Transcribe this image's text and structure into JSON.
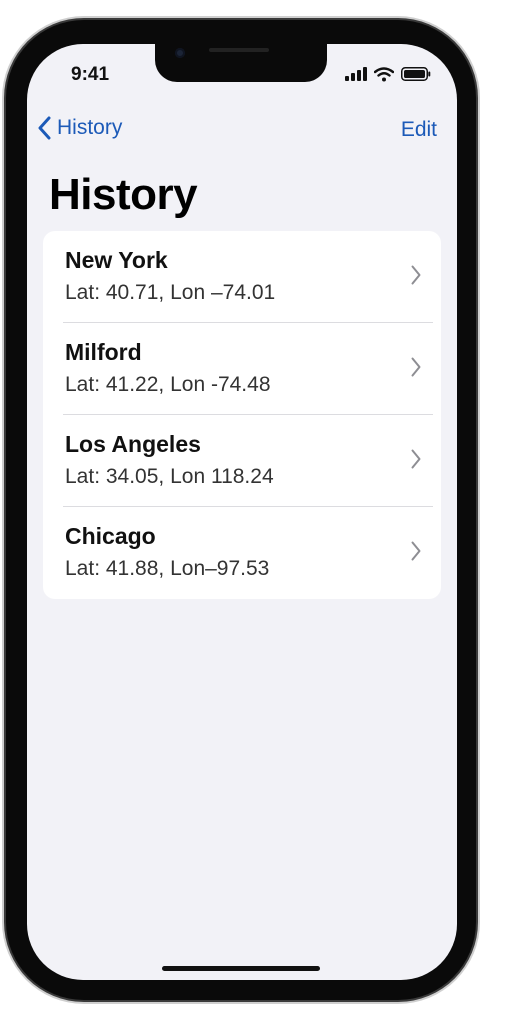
{
  "status_bar": {
    "time": "9:41"
  },
  "nav": {
    "back_label": "History",
    "edit_label": "Edit"
  },
  "title": "History",
  "locations": [
    {
      "name": "New York",
      "coords": "Lat: 40.71, Lon –74.01"
    },
    {
      "name": "Milford",
      "coords": "Lat: 41.22, Lon -74.48"
    },
    {
      "name": "Los Angeles",
      "coords": "Lat: 34.05, Lon 118.24"
    },
    {
      "name": "Chicago",
      "coords": "Lat: 41.88, Lon–97.53"
    }
  ],
  "icons": {
    "back": "chevron-left-icon",
    "row": "chevron-right-icon",
    "signal": "cellular-signal-icon",
    "wifi": "wifi-icon",
    "battery": "battery-icon"
  },
  "colors": {
    "accent": "#1c5ab8",
    "background": "#f2f2f7",
    "card": "#ffffff"
  }
}
